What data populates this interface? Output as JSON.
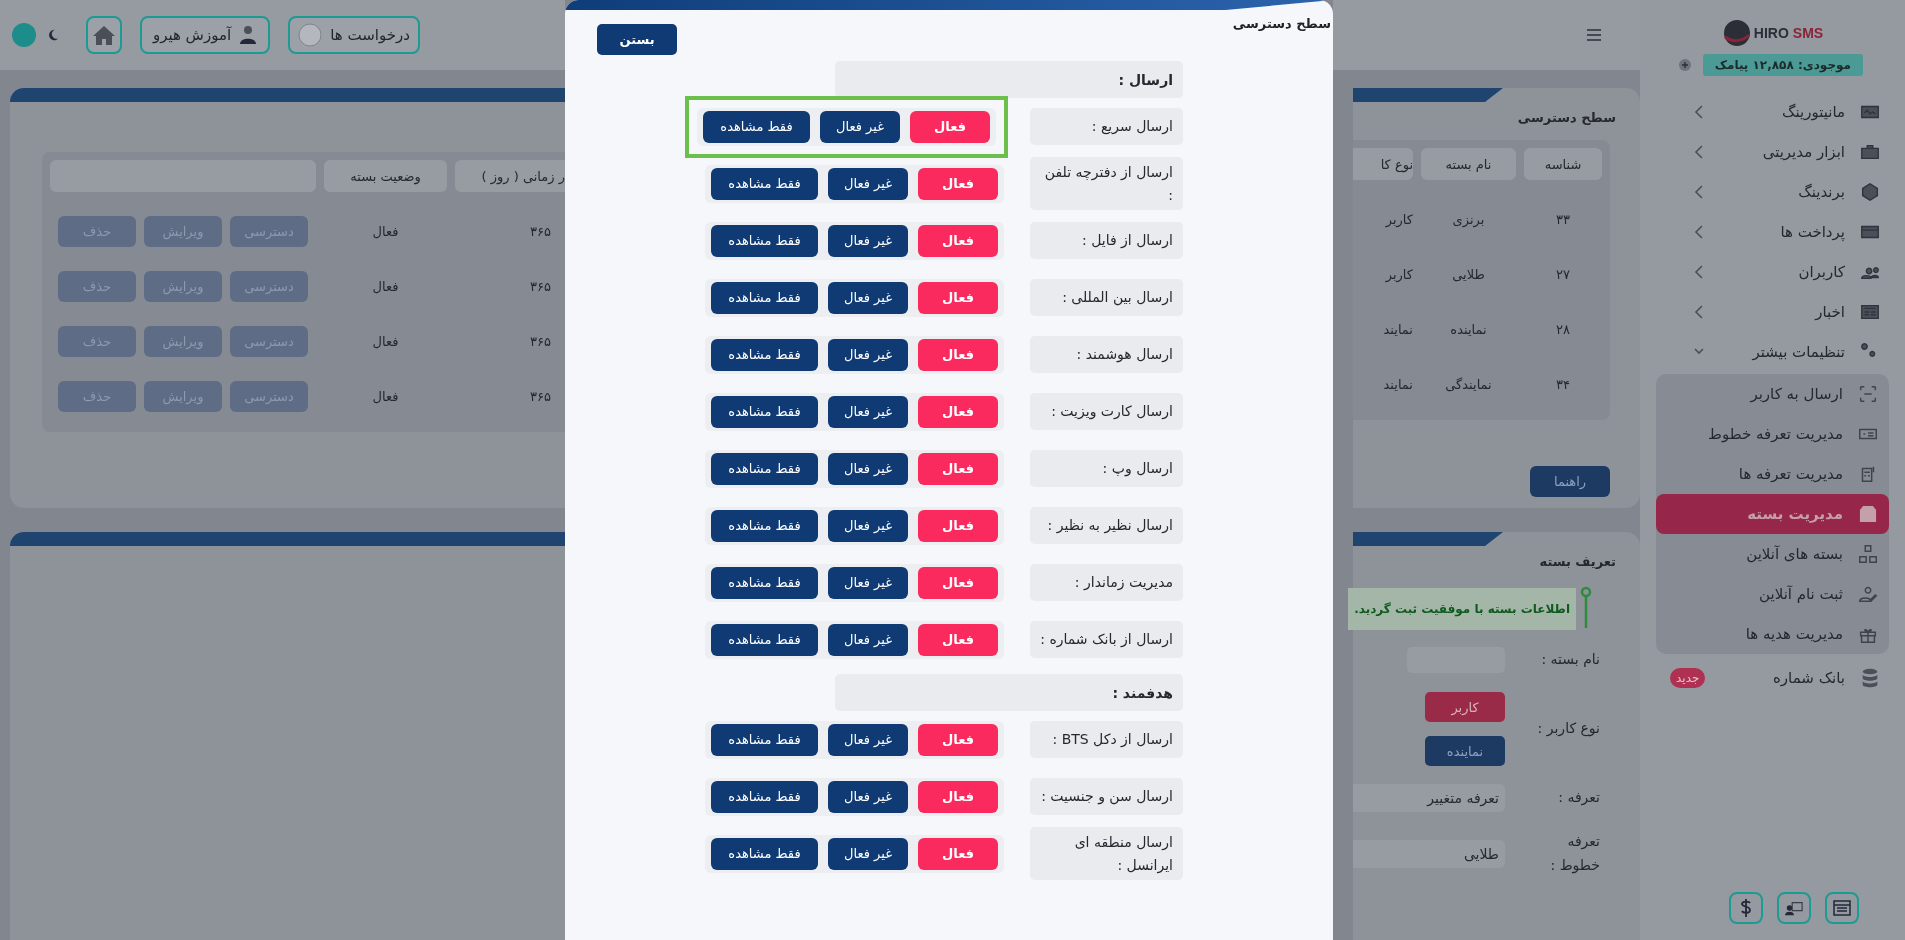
{
  "header": {
    "requests_button": "درخواست ها",
    "tutorial_button": "آموزش هیرو"
  },
  "access_card": {
    "title": "سطح دسترسی",
    "help_button": "راهنما",
    "columns": [
      "شناسه",
      "نام بسته",
      "نوع کا",
      "ر زمانی ( روز )",
      "وضعیت بسته"
    ],
    "rows": [
      {
        "cells": [
          "۳۳",
          "برنزی",
          "کاربر",
          "۳۶۵",
          "فعال"
        ],
        "actions": [
          "دسترسی",
          "ویرایش",
          "حذف"
        ]
      },
      {
        "cells": [
          "۲۷",
          "طلایی",
          "کاربر",
          "۳۶۵",
          "فعال"
        ],
        "actions": [
          "دسترسی",
          "ویرایش",
          "حذف"
        ]
      },
      {
        "cells": [
          "۲۸",
          "نماینده",
          "نمایند",
          "۳۶۵",
          "فعال"
        ],
        "actions": [
          "دسترسی",
          "ویرایش",
          "حذف"
        ]
      },
      {
        "cells": [
          "۳۴",
          "نمایندگی",
          "نمایند",
          "۳۶۵",
          "فعال"
        ],
        "actions": [
          "دسترسی",
          "ویرایش",
          "حذف"
        ]
      }
    ]
  },
  "define_card": {
    "title": "تعریف بسته",
    "alert": "اطلاعات بسته با موفقیت ثبت گردید.",
    "fields": [
      {
        "kind": "input",
        "label": "نام بسته :"
      },
      {
        "kind": "choice",
        "label": "نوع کاربر :",
        "options": [
          {
            "label": "کاربر",
            "selected": true
          },
          {
            "label": "نماینده",
            "selected": false
          }
        ]
      },
      {
        "kind": "select",
        "label": "تعرفه :",
        "value": "تعرفه متغییر"
      },
      {
        "kind": "select",
        "label": "تعرفه خطوط :",
        "value": "طلایی"
      }
    ]
  },
  "modal": {
    "title": "سطح دسترسی",
    "close_button": "بستن",
    "sections": [
      {
        "title": "ارسال :",
        "rows": [
          {
            "label": "ارسال سریع :",
            "highlighted": true,
            "options": [
              {
                "label": "فعال",
                "selected": true
              },
              {
                "label": "غیر فعال",
                "selected": false
              },
              {
                "label": "فقط مشاهده",
                "selected": false
              }
            ]
          },
          {
            "label": "ارسال از دفترچه تلفن :",
            "highlighted": false,
            "options": [
              {
                "label": "فعال",
                "selected": true
              },
              {
                "label": "غیر فعال",
                "selected": false
              },
              {
                "label": "فقط مشاهده",
                "selected": false
              }
            ]
          },
          {
            "label": "ارسال از فایل :",
            "highlighted": false,
            "options": [
              {
                "label": "فعال",
                "selected": true
              },
              {
                "label": "غیر فعال",
                "selected": false
              },
              {
                "label": "فقط مشاهده",
                "selected": false
              }
            ]
          },
          {
            "label": "ارسال بین المللی :",
            "highlighted": false,
            "options": [
              {
                "label": "فعال",
                "selected": true
              },
              {
                "label": "غیر فعال",
                "selected": false
              },
              {
                "label": "فقط مشاهده",
                "selected": false
              }
            ]
          },
          {
            "label": "ارسال هوشمند :",
            "highlighted": false,
            "options": [
              {
                "label": "فعال",
                "selected": true
              },
              {
                "label": "غیر فعال",
                "selected": false
              },
              {
                "label": "فقط مشاهده",
                "selected": false
              }
            ]
          },
          {
            "label": "ارسال کارت ویزیت :",
            "highlighted": false,
            "options": [
              {
                "label": "فعال",
                "selected": true
              },
              {
                "label": "غیر فعال",
                "selected": false
              },
              {
                "label": "فقط مشاهده",
                "selected": false
              }
            ]
          },
          {
            "label": "ارسال وپ :",
            "highlighted": false,
            "options": [
              {
                "label": "فعال",
                "selected": true
              },
              {
                "label": "غیر فعال",
                "selected": false
              },
              {
                "label": "فقط مشاهده",
                "selected": false
              }
            ]
          },
          {
            "label": "ارسال نظیر به نظیر :",
            "highlighted": false,
            "options": [
              {
                "label": "فعال",
                "selected": true
              },
              {
                "label": "غیر فعال",
                "selected": false
              },
              {
                "label": "فقط مشاهده",
                "selected": false
              }
            ]
          },
          {
            "label": "مدیریت زماندار :",
            "highlighted": false,
            "options": [
              {
                "label": "فعال",
                "selected": true
              },
              {
                "label": "غیر فعال",
                "selected": false
              },
              {
                "label": "فقط مشاهده",
                "selected": false
              }
            ]
          },
          {
            "label": "ارسال از بانک شماره :",
            "highlighted": false,
            "options": [
              {
                "label": "فعال",
                "selected": true
              },
              {
                "label": "غیر فعال",
                "selected": false
              },
              {
                "label": "فقط مشاهده",
                "selected": false
              }
            ]
          }
        ]
      },
      {
        "title": "هدفمند :",
        "rows": [
          {
            "label": "ارسال از دکل BTS :",
            "highlighted": false,
            "options": [
              {
                "label": "فعال",
                "selected": true
              },
              {
                "label": "غیر فعال",
                "selected": false
              },
              {
                "label": "فقط مشاهده",
                "selected": false
              }
            ]
          },
          {
            "label": "ارسال سن و جنسیت :",
            "highlighted": false,
            "options": [
              {
                "label": "فعال",
                "selected": true
              },
              {
                "label": "غیر فعال",
                "selected": false
              },
              {
                "label": "فقط مشاهده",
                "selected": false
              }
            ]
          },
          {
            "label": "ارسال منطقه ای ایرانسل :",
            "highlighted": false,
            "options": [
              {
                "label": "فعال",
                "selected": true
              },
              {
                "label": "غیر فعال",
                "selected": false
              },
              {
                "label": "فقط مشاهده",
                "selected": false
              }
            ]
          }
        ]
      }
    ]
  },
  "sidebar": {
    "logo": {
      "part_1": "HIRO",
      "part_2": "SMS"
    },
    "balance": "موجودی: ۱۲,۸۵۸ پیامک",
    "items": [
      {
        "kind": "group",
        "label": "مانیتورینگ",
        "expanded": false
      },
      {
        "kind": "group",
        "label": "ابزار مدیریتی",
        "expanded": false
      },
      {
        "kind": "group",
        "label": "برندینگ",
        "expanded": false
      },
      {
        "kind": "group",
        "label": "پرداخت ها",
        "expanded": false
      },
      {
        "kind": "group",
        "label": "کاربران",
        "expanded": false
      },
      {
        "kind": "group",
        "label": "اخبار",
        "expanded": false
      },
      {
        "kind": "group",
        "label": "تنظیمات بیشتر",
        "expanded": true,
        "children": [
          {
            "label": "ارسال به کاربر",
            "selected": false
          },
          {
            "label": "مدیریت تعرفه خطوط",
            "selected": false
          },
          {
            "label": "مدیریت تعرفه ها",
            "selected": false
          },
          {
            "label": "مدیریت بسته",
            "selected": true
          },
          {
            "label": "بسته های آنلاین",
            "selected": false
          },
          {
            "label": "ثبت نام آنلاین",
            "selected": false
          },
          {
            "label": "مدیریت هدیه ها",
            "selected": false
          }
        ]
      },
      {
        "kind": "link",
        "label": "بانک شماره",
        "badge": "جدید"
      }
    ]
  }
}
